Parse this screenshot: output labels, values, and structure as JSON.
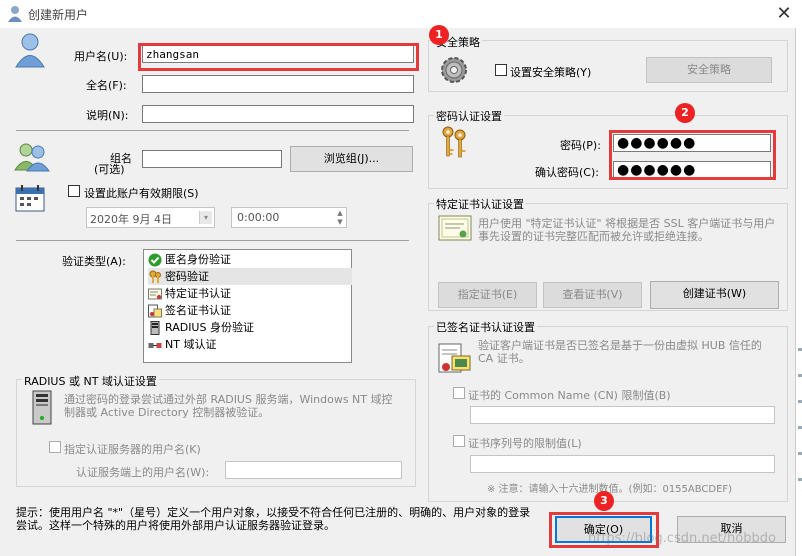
{
  "window": {
    "title": "创建新用户",
    "close_glyph": "✕"
  },
  "user": {
    "username_label": "用户名(U):",
    "username_value": "zhangsan",
    "fullname_label": "全名(F):",
    "fullname_value": "",
    "description_label": "说明(N):",
    "description_value": "",
    "group_label_line1": "组名",
    "group_label_line2": "(可选)",
    "group_value": "",
    "browse_group_button": "浏览组(J)...",
    "expiry_checkbox_label": "设置此账户有效期限(S)",
    "expiry_date": "2020年 9月 4日",
    "expiry_time": "0:00:00"
  },
  "auth": {
    "type_label": "验证类型(A):",
    "items": [
      {
        "label": "匿名身份验证",
        "icon": "green-check-icon",
        "selected": false
      },
      {
        "label": "密码验证",
        "icon": "keys-icon",
        "selected": true
      },
      {
        "label": "特定证书认证",
        "icon": "certificate-icon",
        "selected": false
      },
      {
        "label": "签名证书认证",
        "icon": "signed-certificate-icon",
        "selected": false
      },
      {
        "label": "RADIUS 身份验证",
        "icon": "server-icon",
        "selected": false
      },
      {
        "label": "NT 域认证",
        "icon": "network-icon",
        "selected": false
      }
    ]
  },
  "radius": {
    "title": "RADIUS 或 NT 域认证设置",
    "description": "通过密码的登录尝试通过外部 RADIUS 服务端，Windows NT 域控制器或 Active Directory 控制器被验证。",
    "specify_checkbox_label": "指定认证服务器的用户名(K)",
    "server_username_label": "认证服务端上的用户名(W):",
    "server_username_value": ""
  },
  "hint": {
    "text": "提示：使用用户名 \"*\"（星号）定义一个用户对象，以接受不符合任何已注册的、明确的、用户对象的登录尝试。这样一个特殊的用户将使用外部用户认证服务器验证登录。"
  },
  "security_policy": {
    "title": "安全策略",
    "checkbox_label": "设置安全策略(Y)",
    "button_label": "安全策略"
  },
  "password": {
    "title": "密码认证设置",
    "password_label": "密码(P):",
    "password_value": "●●●●●●",
    "confirm_label": "确认密码(C):",
    "confirm_value": "●●●●●●"
  },
  "specific_cert": {
    "title": "特定证书认证设置",
    "description": "用户使用 \"特定证书认证\" 将根据是否 SSL 客户端证书与用户事先设置的证书完整匹配而被允许或拒绝连接。",
    "specify_button": "指定证书(E)",
    "view_button": "查看证书(V)",
    "create_button": "创建证书(W)"
  },
  "signed_cert": {
    "title": "已签名证书认证设置",
    "description": "验证客户端证书是否已签名是基于一份由虚拟 HUB 信任的 CA 证书。",
    "cn_checkbox_label": "证书的 Common Name (CN) 限制值(B)",
    "cn_value": "",
    "serial_checkbox_label": "证书序列号的限制值(L)",
    "serial_value": "",
    "note": "※ 注意：请输入十六进制数值。(例如：0155ABCDEF)"
  },
  "footer": {
    "ok_button": "确定(O)",
    "cancel_button": "取消",
    "watermark": "https://blog.csdn.net/hobbdo"
  },
  "annotations": [
    "1",
    "2",
    "3"
  ],
  "colors": {
    "highlight_red": "#e33b3b",
    "badge_red": "#e22222",
    "dialog_bg": "#f0f0f0",
    "list_selection": "#e5e5e5"
  }
}
